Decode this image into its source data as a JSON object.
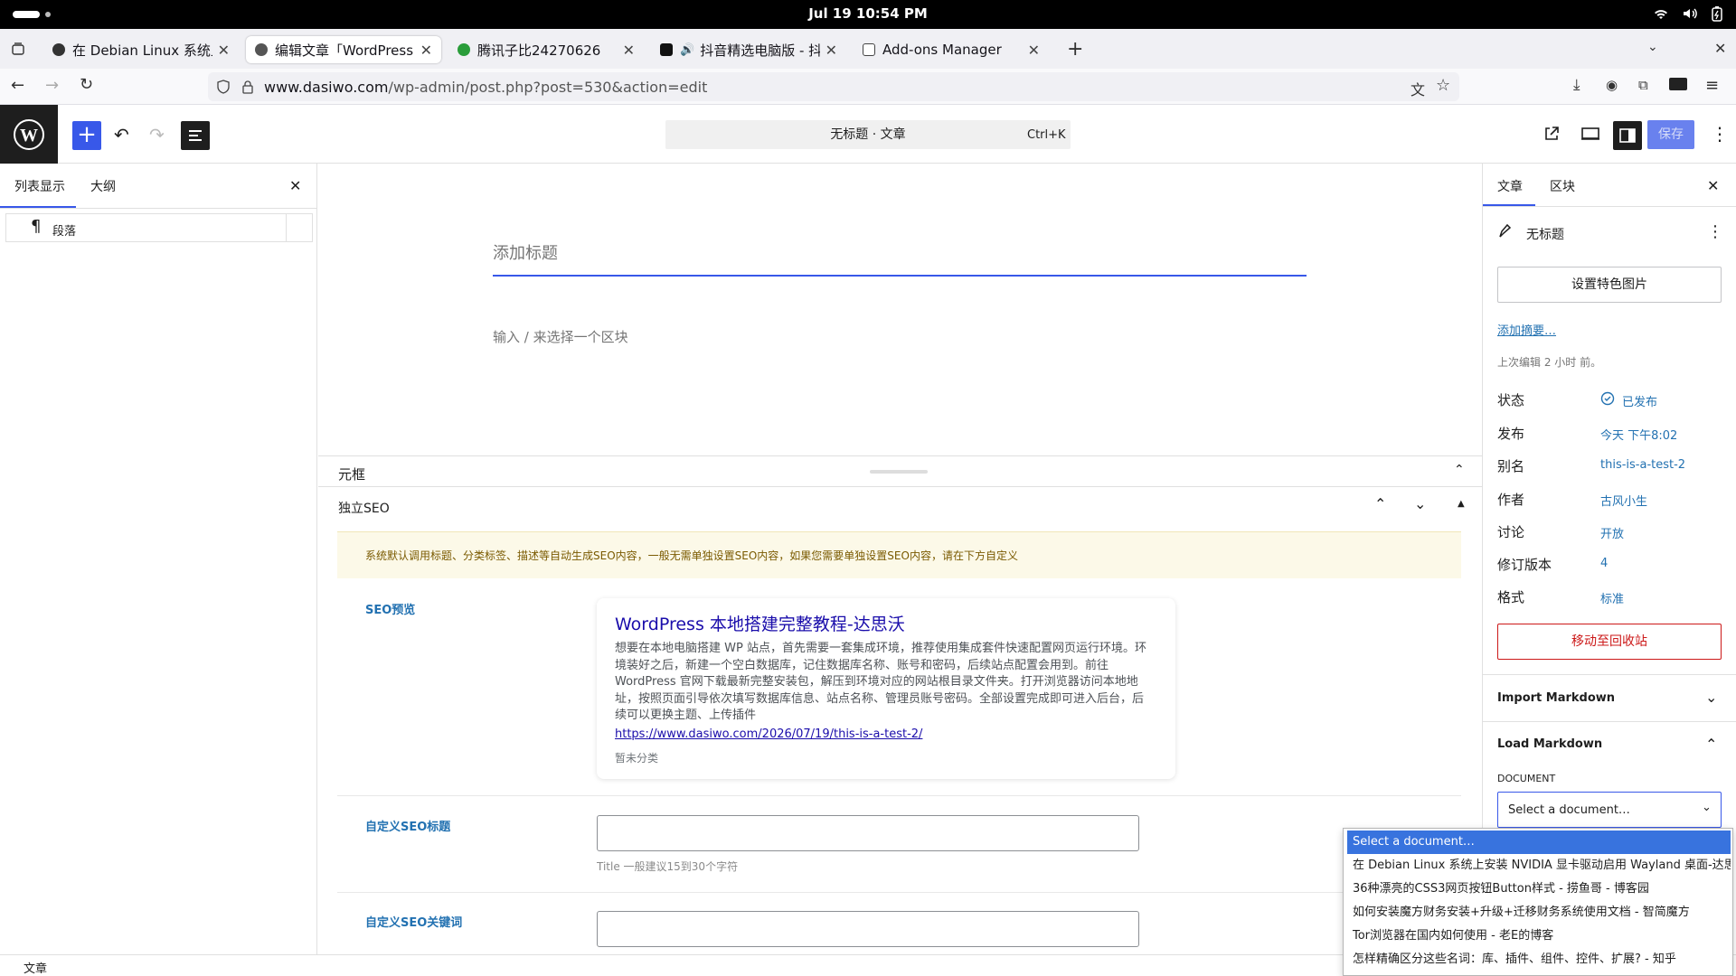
{
  "system_bar": {
    "clock": "Jul 19  10:54 PM"
  },
  "tabs": [
    {
      "label": "在 Debian Linux 系统上安装",
      "active": false
    },
    {
      "label": "编辑文章「WordPress 本地",
      "active": true
    },
    {
      "label": "腾讯子比24270626",
      "active": false
    },
    {
      "label": "抖音精选电脑版 - 抖音",
      "active": false
    },
    {
      "label": "Add-ons Manager",
      "active": false
    }
  ],
  "url": {
    "host": "www.dasiwo.com",
    "path": "/wp-admin/post.php?post=530&action=edit"
  },
  "toolbar": {
    "doc_title": "无标题 · 文章",
    "shortcut": "Ctrl+K",
    "save_label": "保存"
  },
  "left_panel": {
    "tabs": [
      "列表显示",
      "大纲"
    ],
    "items": [
      {
        "label": "段落"
      }
    ]
  },
  "editor": {
    "title_placeholder": "添加标题",
    "block_placeholder": "输入 / 来选择一个区块"
  },
  "meta": {
    "header": "元框",
    "seo_header": "独立SEO",
    "notice": "系统默认调用标题、分类标签、描述等自动生成SEO内容，一般无需单独设置SEO内容，如果您需要单独设置SEO内容，请在下方自定义",
    "preview_label": "SEO预览",
    "preview": {
      "title": "WordPress 本地搭建完整教程-达思沃",
      "desc": "想要在本地电脑搭建 WP 站点，首先需要一套集成环境，推荐使用集成套件快速配置网页运行环境。环境装好之后，新建一个空白数据库，记住数据库名称、账号和密码，后续站点配置会用到。前往WordPress 官网下载最新完整安装包，解压到环境对应的网站根目录文件夹。打开浏览器访问本地地址，按照页面引导依次填写数据库信息、站点名称、管理员账号密码。全部设置完成即可进入后台，后续可以更换主题、上传插件",
      "url": "https://www.dasiwo.com/2026/07/19/this-is-a-test-2/",
      "category": "暂未分类"
    },
    "custom_title_label": "自定义SEO标题",
    "custom_title_hint": "Title 一般建议15到30个字符",
    "custom_keywords_label": "自定义SEO关键词"
  },
  "status_bar": {
    "text": "文章"
  },
  "sidebar": {
    "tabs": [
      "文章",
      "区块"
    ],
    "post_title": "无标题",
    "featured_image": "设置特色图片",
    "add_excerpt": "添加摘要…",
    "last_edited": "上次编辑 2 小时 前。",
    "rows": [
      {
        "label": "状态",
        "value": "已发布"
      },
      {
        "label": "发布",
        "value": "今天 下午8:02"
      },
      {
        "label": "别名",
        "value": "this-is-a-test-2"
      },
      {
        "label": "作者",
        "value": "古风小生"
      },
      {
        "label": "讨论",
        "value": "开放"
      },
      {
        "label": "修订版本",
        "value": "4"
      },
      {
        "label": "格式",
        "value": "标准"
      }
    ],
    "trash": "移动至回收站",
    "import_markdown": "Import Markdown",
    "load_markdown": "Load Markdown",
    "document_label": "DOCUMENT",
    "select_value": "Select a document…"
  },
  "dropdown": {
    "options": [
      "Select a document…",
      "在 Debian Linux 系统上安装 NVIDIA 显卡驱动启用 Wayland 桌面-达思沃",
      "36种漂亮的CSS3网页按钮Button样式 - 捞鱼哥 - 博客园",
      "如何安装魔方财务安装+升级+迁移财务系统使用文档 - 智简魔方",
      "Tor浏览器在国内如何使用 - 老E的博客",
      "怎样精确区分这些名词：库、插件、组件、控件、扩展? - 知乎"
    ]
  },
  "colors": {
    "accent": "#3858e9",
    "danger": "#cc1818",
    "link": "#2271b1"
  }
}
